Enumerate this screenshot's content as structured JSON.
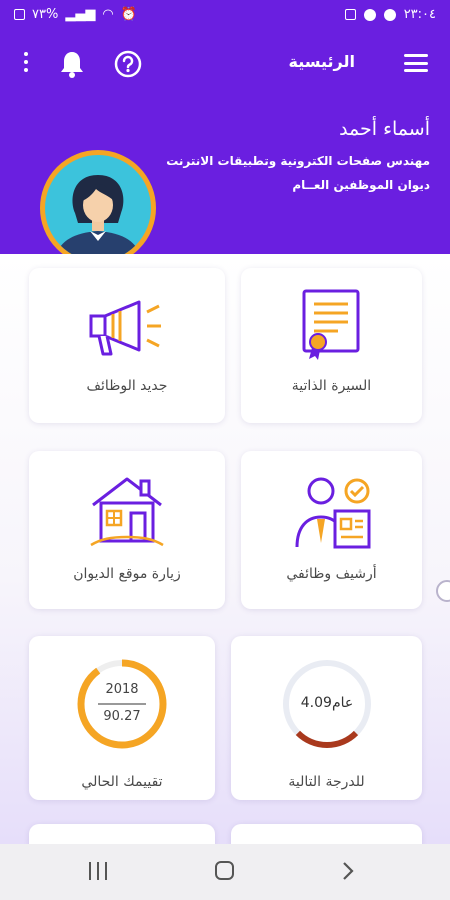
{
  "status_bar": {
    "time": "٢٣:٠٤",
    "battery": "٧٣%"
  },
  "header": {
    "title": "الرئيسية",
    "menu_icon": "hamburger-menu-icon",
    "help_icon": "help-circle-icon",
    "notifications_icon": "bell-icon",
    "more_icon": "more-vertical-icon",
    "bg_color": "#6a1fe0"
  },
  "profile": {
    "name": "أسماء أحمد",
    "job_title": "مهندس صفحات الكترونية وتطبيقات الانترنت",
    "department": "ديوان الموظفين العــام",
    "avatar_icon": "female-avatar-icon"
  },
  "cards": {
    "cv": {
      "label": "السيرة الذاتية",
      "icon": "certificate-icon"
    },
    "new_jobs": {
      "label": "جديد الوظائف",
      "icon": "megaphone-icon"
    },
    "archive": {
      "label": "أرشيف وظائفي",
      "icon": "employee-archive-icon"
    },
    "visit_site": {
      "label": "زيارة موقع الديوان",
      "icon": "house-icon"
    },
    "next_grade": {
      "label": "للدرجة التالية",
      "value": "4.09",
      "unit": "عام",
      "progress": 0.25,
      "color": "#a9391d"
    },
    "rating": {
      "label": "تقييمك الحالي",
      "year": "2018",
      "score": "90.27",
      "progress": 0.9,
      "color": "#f5a524"
    }
  },
  "accent_colors": {
    "purple": "#6a1fe0",
    "orange": "#f5a524"
  },
  "nav_bar": {
    "recent_icon": "recent-apps-icon",
    "home_icon": "home-icon",
    "back_icon": "back-chevron-icon"
  }
}
